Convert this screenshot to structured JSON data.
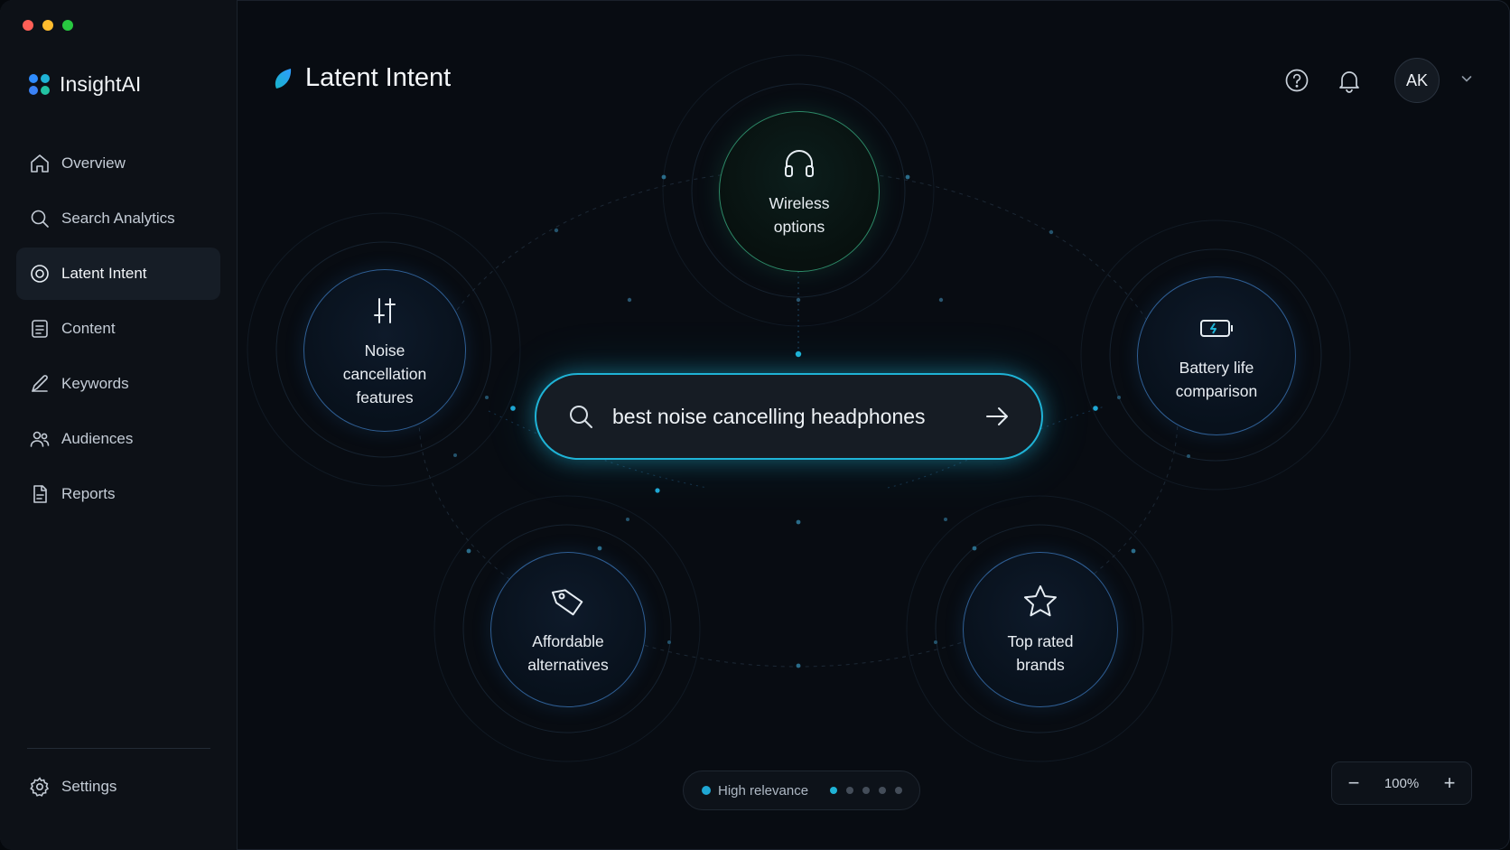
{
  "window": {
    "controls": [
      "close",
      "minimize",
      "maximize"
    ]
  },
  "brand": {
    "name": "InsightAI",
    "logo_colors": [
      "#2f8cff",
      "#1fb3d6",
      "#3b82f6",
      "#22c3a3"
    ]
  },
  "sidebar": {
    "items": [
      {
        "label": "Overview",
        "icon": "home-icon",
        "active": false
      },
      {
        "label": "Search Analytics",
        "icon": "search-icon",
        "active": false
      },
      {
        "label": "Latent Intent",
        "icon": "target-icon",
        "active": true
      },
      {
        "label": "Content",
        "icon": "document-icon",
        "active": false
      },
      {
        "label": "Keywords",
        "icon": "pen-icon",
        "active": false
      },
      {
        "label": "Audiences",
        "icon": "users-icon",
        "active": false
      },
      {
        "label": "Reports",
        "icon": "report-icon",
        "active": false
      }
    ],
    "settings": {
      "label": "Settings",
      "icon": "gear-icon"
    }
  },
  "header": {
    "title": "Latent Intent",
    "user_initials": "AK",
    "icons": [
      "help-icon",
      "bell-icon",
      "chevron-down-icon"
    ]
  },
  "search": {
    "query": "best noise cancelling headphones",
    "icon": "search-icon",
    "submit_icon": "arrow-right-icon"
  },
  "intents": [
    {
      "label": "Wireless\noptions",
      "icon": "headphones-icon",
      "accent": "#2d8a68"
    },
    {
      "label": "Noise\ncancellation\nfeatures",
      "icon": "sliders-icon",
      "accent": "#2f5f95"
    },
    {
      "label": "Battery life\ncomparison",
      "icon": "battery-icon",
      "accent": "#2f5f95"
    },
    {
      "label": "Affordable\nalternatives",
      "icon": "tag-icon",
      "accent": "#2f5f95"
    },
    {
      "label": "Top rated\nbrands",
      "icon": "star-icon",
      "accent": "#2f5f95"
    }
  ],
  "legend": {
    "label": "High relevance",
    "color": "#1fa7d4",
    "pages": 5,
    "active_page": 1
  },
  "zoom": {
    "minus": "−",
    "value": "100%",
    "plus": "+"
  },
  "colors": {
    "accent": "#1fb3d6",
    "background": "#080c12",
    "sidebar": "#0d1117"
  }
}
